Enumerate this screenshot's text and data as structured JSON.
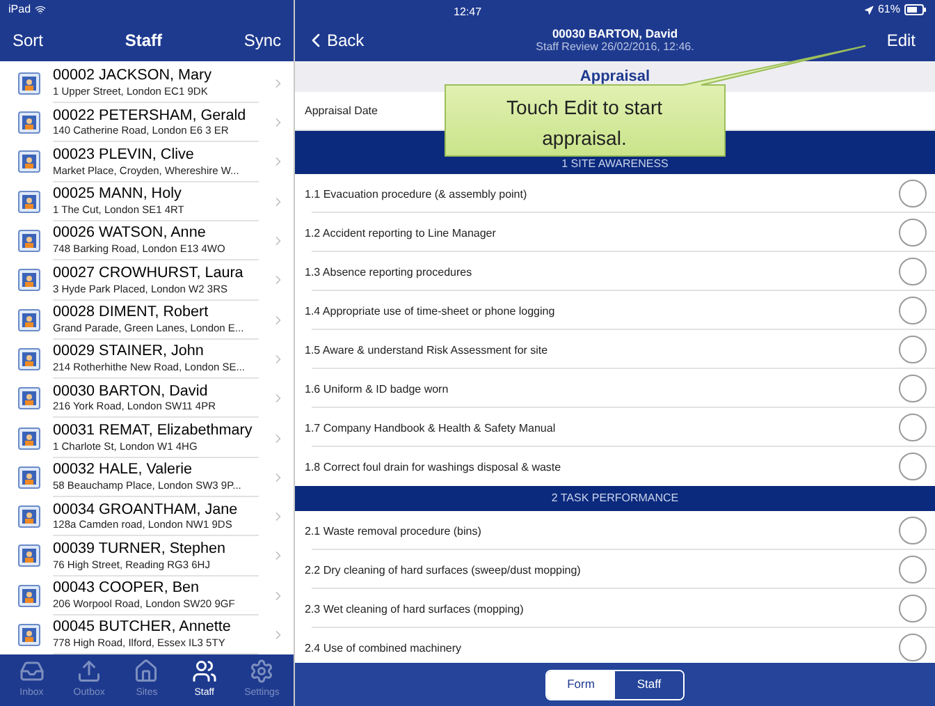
{
  "status_bar": {
    "device": "iPad",
    "time": "12:47",
    "battery": "61%"
  },
  "left_nav": {
    "left": "Sort",
    "title": "Staff",
    "right": "Sync"
  },
  "staff": [
    {
      "name": "00002 JACKSON, Mary",
      "address": "1 Upper Street, London EC1 9DK"
    },
    {
      "name": "00022 PETERSHAM, Gerald",
      "address": "140 Catherine Road, London E6 3 ER"
    },
    {
      "name": "00023 PLEVIN, Clive",
      "address": "Market Place, Croyden, Whereshire W..."
    },
    {
      "name": "00025 MANN, Holy",
      "address": "1 The Cut, London SE1 4RT"
    },
    {
      "name": "00026 WATSON, Anne",
      "address": "748 Barking Road, London E13 4WO"
    },
    {
      "name": "00027 CROWHURST, Laura",
      "address": "3 Hyde Park Placed, London W2 3RS"
    },
    {
      "name": "00028 DIMENT, Robert",
      "address": "Grand Parade, Green Lanes, London E..."
    },
    {
      "name": "00029 STAINER, John",
      "address": "214 Rotherhithe New Road, London SE..."
    },
    {
      "name": "00030 BARTON, David",
      "address": "216 York Road, London SW11 4PR"
    },
    {
      "name": "00031 REMAT, Elizabethmary",
      "address": "1 Charlote St, London W1 4HG"
    },
    {
      "name": "00032 HALE, Valerie",
      "address": "58 Beauchamp Place, London SW3 9P..."
    },
    {
      "name": "00034 GROANTHAM, Jane",
      "address": "128a Camden road, London NW1 9DS"
    },
    {
      "name": "00039 TURNER, Stephen",
      "address": "76 High Street, Reading RG3 6HJ"
    },
    {
      "name": "00043 COOPER, Ben",
      "address": "206 Worpool Road, London SW20 9GF"
    },
    {
      "name": "00045 BUTCHER, Annette",
      "address": "778 High Road, Ilford, Essex IL3 5TY"
    }
  ],
  "tab_bar": [
    {
      "label": "Inbox",
      "kind": "inbox",
      "selected": false
    },
    {
      "label": "Outbox",
      "kind": "outbox",
      "selected": false
    },
    {
      "label": "Sites",
      "kind": "sites",
      "selected": false
    },
    {
      "label": "Staff",
      "kind": "staff",
      "selected": true
    },
    {
      "label": "Settings",
      "kind": "settings",
      "selected": false
    }
  ],
  "right_nav": {
    "back": "Back",
    "title": "00030 BARTON, David",
    "subtitle": "Staff Review 26/02/2016, 12:46.",
    "right": "Edit"
  },
  "form_title": "Appraisal",
  "appraisal_date_label": "Appraisal Date",
  "sections": [
    {
      "title": "1 SITE AWARENESS",
      "items": [
        {
          "label": "1.1 Evacuation procedure (& assembly point)",
          "checked": false
        },
        {
          "label": "1.2 Accident reporting to Line Manager",
          "checked": false
        },
        {
          "label": "1.3 Absence reporting procedures",
          "checked": false
        },
        {
          "label": "1.4 Appropriate use of time-sheet or phone logging",
          "checked": false
        },
        {
          "label": "1.5 Aware & understand Risk Assessment for site",
          "checked": false
        },
        {
          "label": "1.6 Uniform & ID badge worn",
          "checked": false
        },
        {
          "label": "1.7 Company Handbook & Health & Safety Manual",
          "checked": false
        },
        {
          "label": "1.8 Correct foul drain for washings disposal & waste",
          "checked": false
        }
      ]
    },
    {
      "title": "2 TASK PERFORMANCE",
      "items": [
        {
          "label": "2.1 Waste removal procedure (bins)",
          "checked": false
        },
        {
          "label": "2.2 Dry cleaning of hard surfaces (sweep/dust mopping)",
          "checked": false
        },
        {
          "label": "2.3 Wet cleaning of hard surfaces (mopping)",
          "checked": false
        },
        {
          "label": "2.4 Use of combined machinery",
          "checked": false
        }
      ]
    }
  ],
  "segments": [
    {
      "label": "Form",
      "selected": true
    },
    {
      "label": "Staff",
      "selected": false
    }
  ],
  "callout": "Touch Edit to start appraisal."
}
